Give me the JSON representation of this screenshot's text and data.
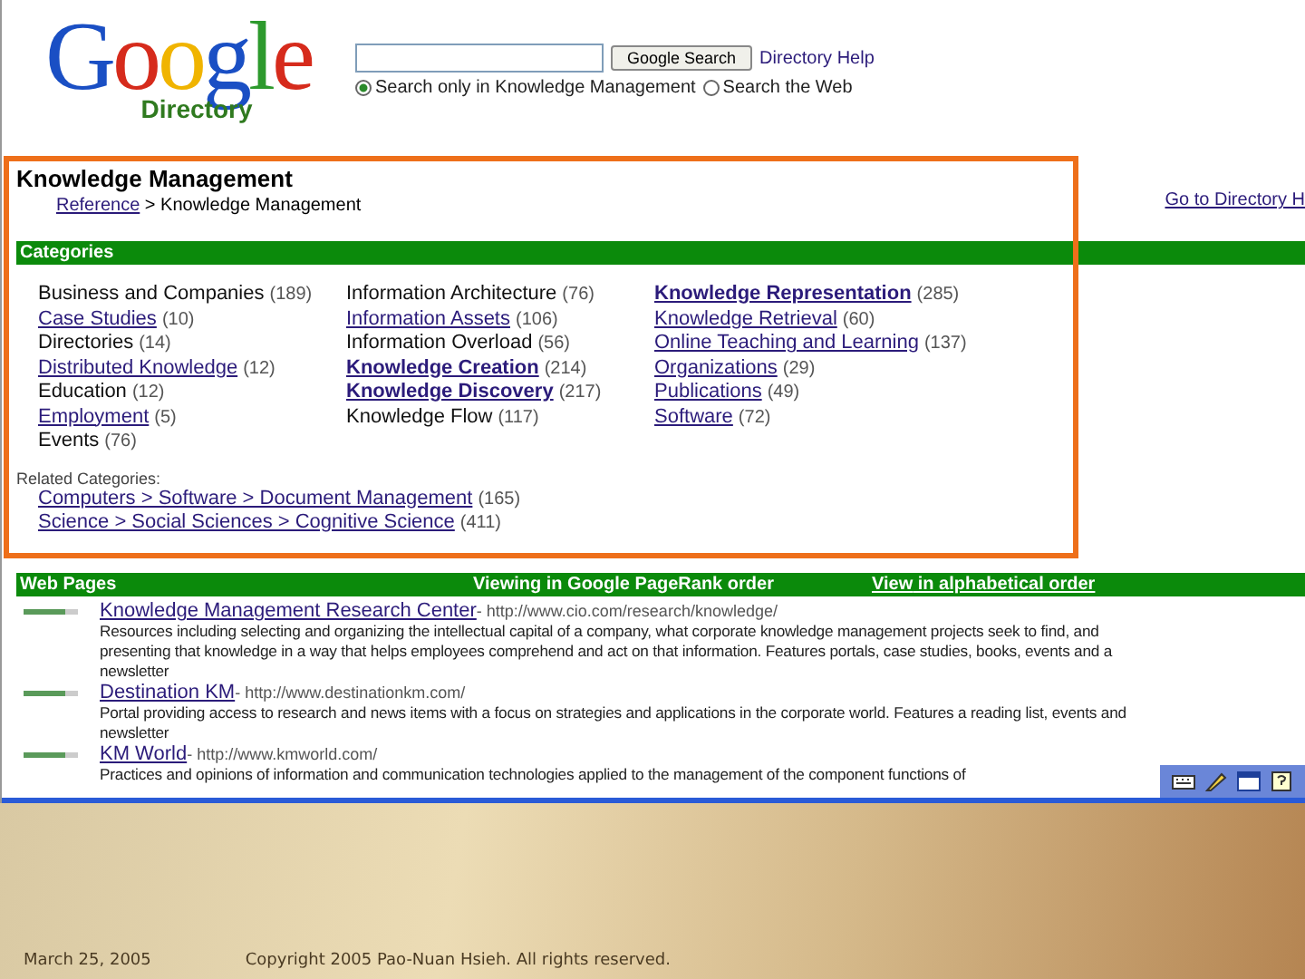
{
  "header": {
    "logo": "Google",
    "logo_sub": "Directory",
    "search": {
      "button": "Google Search"
    },
    "help_link": "Directory Help",
    "radios": [
      {
        "label": "Search only in Knowledge Management",
        "selected": true
      },
      {
        "label": "Search the Web",
        "selected": false
      }
    ]
  },
  "page": {
    "title": "Knowledge Management",
    "breadcrumb": {
      "link": "Reference",
      "rest": " > Knowledge Management"
    },
    "top_link": "Go to Directory H"
  },
  "categories": {
    "heading": "Categories",
    "columns": [
      [
        {
          "name": "Business and Companies",
          "count": "(189)",
          "linked": false,
          "bold": false
        },
        {
          "name": "Case Studies",
          "count": "(10)",
          "linked": true,
          "bold": false
        },
        {
          "name": "Directories",
          "count": "(14)",
          "linked": false,
          "bold": false
        },
        {
          "name": "Distributed Knowledge",
          "count": "(12)",
          "linked": true,
          "bold": false
        },
        {
          "name": "Education",
          "count": "(12)",
          "linked": false,
          "bold": false
        },
        {
          "name": "Employment",
          "count": "(5)",
          "linked": true,
          "bold": false
        },
        {
          "name": "Events",
          "count": "(76)",
          "linked": false,
          "bold": false
        }
      ],
      [
        {
          "name": "Information Architecture",
          "count": "(76)",
          "linked": false,
          "bold": false
        },
        {
          "name": "Information Assets",
          "count": "(106)",
          "linked": true,
          "bold": false
        },
        {
          "name": "Information Overload",
          "count": "(56)",
          "linked": false,
          "bold": false
        },
        {
          "name": "Knowledge Creation",
          "count": "(214)",
          "linked": true,
          "bold": true
        },
        {
          "name": "Knowledge Discovery",
          "count": "(217)",
          "linked": true,
          "bold": true
        },
        {
          "name": "Knowledge Flow",
          "count": "(117)",
          "linked": false,
          "bold": false
        }
      ],
      [
        {
          "name": "Knowledge Representation",
          "count": "(285)",
          "linked": true,
          "bold": true
        },
        {
          "name": "Knowledge Retrieval",
          "count": "(60)",
          "linked": true,
          "bold": false
        },
        {
          "name": "Online Teaching and Learning",
          "count": "(137)",
          "linked": true,
          "bold": false
        },
        {
          "name": "Organizations",
          "count": "(29)",
          "linked": true,
          "bold": false
        },
        {
          "name": "Publications",
          "count": "(49)",
          "linked": true,
          "bold": false
        },
        {
          "name": "Software",
          "count": "(72)",
          "linked": true,
          "bold": false
        }
      ]
    ],
    "related_label": "Related Categories:",
    "related": [
      {
        "path": "Computers > Software > Document Management",
        "count": "(165)"
      },
      {
        "path": "Science > Social Sciences > Cognitive Science",
        "count": "(411)"
      }
    ]
  },
  "web_pages": {
    "heading": "Web Pages",
    "order_text": "Viewing in Google PageRank order",
    "order_link": "**View** in alphabetical order",
    "results": [
      {
        "title": "Knowledge Management Research Center",
        "url": " - http://www.cio.com/research/knowledge/",
        "level": 0.75,
        "lines": [
          "Resources including selecting and organizing the intellectual capital of a company, what corporate knowledge management projects seek to find, and",
          "presenting that knowledge in a way that helps employees comprehend and act on that information. Features portals, case studies, books, events and a",
          "newsletter"
        ]
      },
      {
        "title": "Destination KM",
        "url": " - http://www.destinationkm.com/",
        "level": 0.75,
        "lines": [
          "Portal providing access to research and news items with a focus on strategies and applications in the corporate world. Features a reading list, events and",
          "newsletter"
        ]
      },
      {
        "title": "KM World",
        "url": " - http://www.kmworld.com/",
        "level": 0.75,
        "lines": [
          "Practices and opinions of information and communication technologies applied to the management of the component functions of"
        ]
      }
    ]
  },
  "footer": {
    "date": "March 25, 2005",
    "copyright": "Copyright 2005 Pao-Nuan Hsieh. All rights reserved."
  }
}
